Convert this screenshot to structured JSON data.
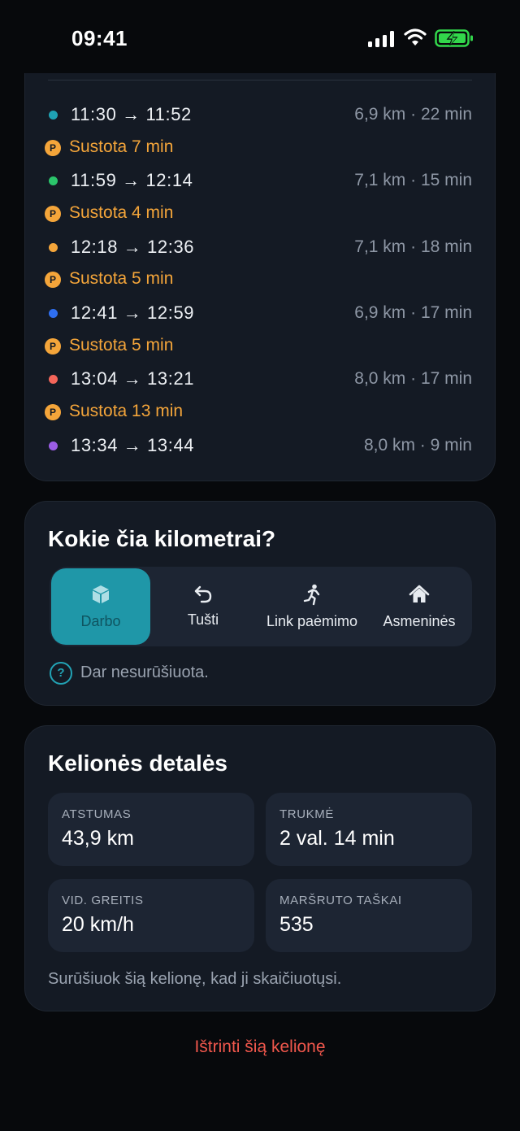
{
  "status_bar": {
    "time": "09:41",
    "icons": [
      "signal-icon",
      "wifi-icon",
      "battery-charging-icon"
    ],
    "battery_color": "#32d74b"
  },
  "segments": [
    {
      "time": "11:30 → 11:52",
      "meta": "6,9 km · 22 min",
      "color": "#1fa2b4"
    },
    {
      "stop": "Sustota 7 min"
    },
    {
      "time": "11:59 → 12:14",
      "meta": "7,1 km · 15 min",
      "color": "#2bc56b"
    },
    {
      "stop": "Sustota 4 min"
    },
    {
      "time": "12:18 → 12:36",
      "meta": "7,1 km · 18 min",
      "color": "#f4a53a"
    },
    {
      "stop": "Sustota 5 min"
    },
    {
      "time": "12:41 → 12:59",
      "meta": "6,9 km · 17 min",
      "color": "#2f6ff0"
    },
    {
      "stop": "Sustota 5 min"
    },
    {
      "time": "13:04 → 13:21",
      "meta": "8,0 km · 17 min",
      "color": "#f4665a"
    },
    {
      "stop": "Sustota 13 min"
    },
    {
      "time": "13:34 → 13:44",
      "meta": "8,0 km · 9 min",
      "color": "#9b5de5"
    }
  ],
  "stop_badge": "P",
  "category": {
    "title": "Kokie čia kilometrai?",
    "options": [
      {
        "label": "Darbo",
        "icon": "briefcase-icon",
        "selected": true
      },
      {
        "label": "Tušti",
        "icon": "return-arrow-icon",
        "selected": false
      },
      {
        "label": "Link paėmimo",
        "icon": "running-person-icon",
        "selected": false
      },
      {
        "label": "Asmeninės",
        "icon": "house-icon",
        "selected": false
      }
    ],
    "help_glyph": "?",
    "help_text": "Dar nesurūšiuota."
  },
  "details": {
    "title": "Kelionės detalės",
    "tiles": [
      {
        "label": "ATSTUMAS",
        "value": "43,9 km"
      },
      {
        "label": "TRUKMĖ",
        "value": "2 val. 14 min"
      },
      {
        "label": "VID. GREITIS",
        "value": "20 km/h"
      },
      {
        "label": "MARŠRUTO TAŠKAI",
        "value": "535"
      }
    ],
    "note": "Surūšiuok šią kelionę, kad ji skaičiuotųsi."
  },
  "delete_label": "Ištrinti šią kelionę",
  "colors": {
    "accent": "#1f97a8",
    "stop": "#f4a53a",
    "danger": "#f0574c",
    "card": "#141a24",
    "background": "#07090c"
  }
}
